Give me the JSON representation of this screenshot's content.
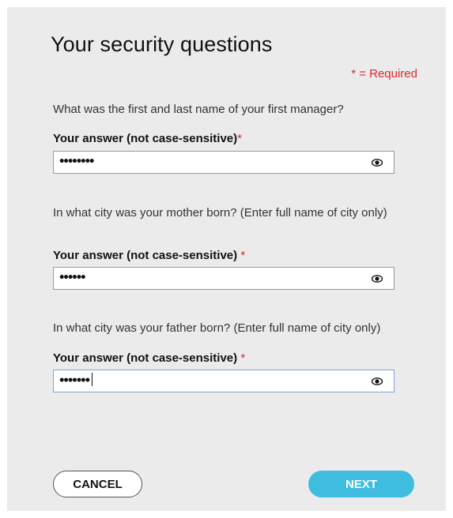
{
  "page": {
    "title": "Your security questions",
    "required_legend": "* = Required"
  },
  "questions": [
    {
      "prompt": "What was the first and last name of your first manager?",
      "label": "Your answer (not case-sensitive)",
      "required_mark": "*",
      "value": "••••••••",
      "focused": false
    },
    {
      "prompt": "In what city was your mother born? (Enter full name of city only)",
      "label": "Your answer (not case-sensitive)",
      "required_mark": "*",
      "value": "••••••",
      "focused": false
    },
    {
      "prompt": "In what city was your father born? (Enter full name of city only)",
      "label": "Your answer (not case-sensitive)",
      "required_mark": "*",
      "value": "•••••••",
      "focused": true
    }
  ],
  "buttons": {
    "cancel": "CANCEL",
    "next": "NEXT"
  },
  "icons": {
    "show_password": "eye-icon"
  },
  "colors": {
    "panel_background": "#ebebeb",
    "required_red": "#d8282f",
    "next_button": "#3fbde0"
  }
}
